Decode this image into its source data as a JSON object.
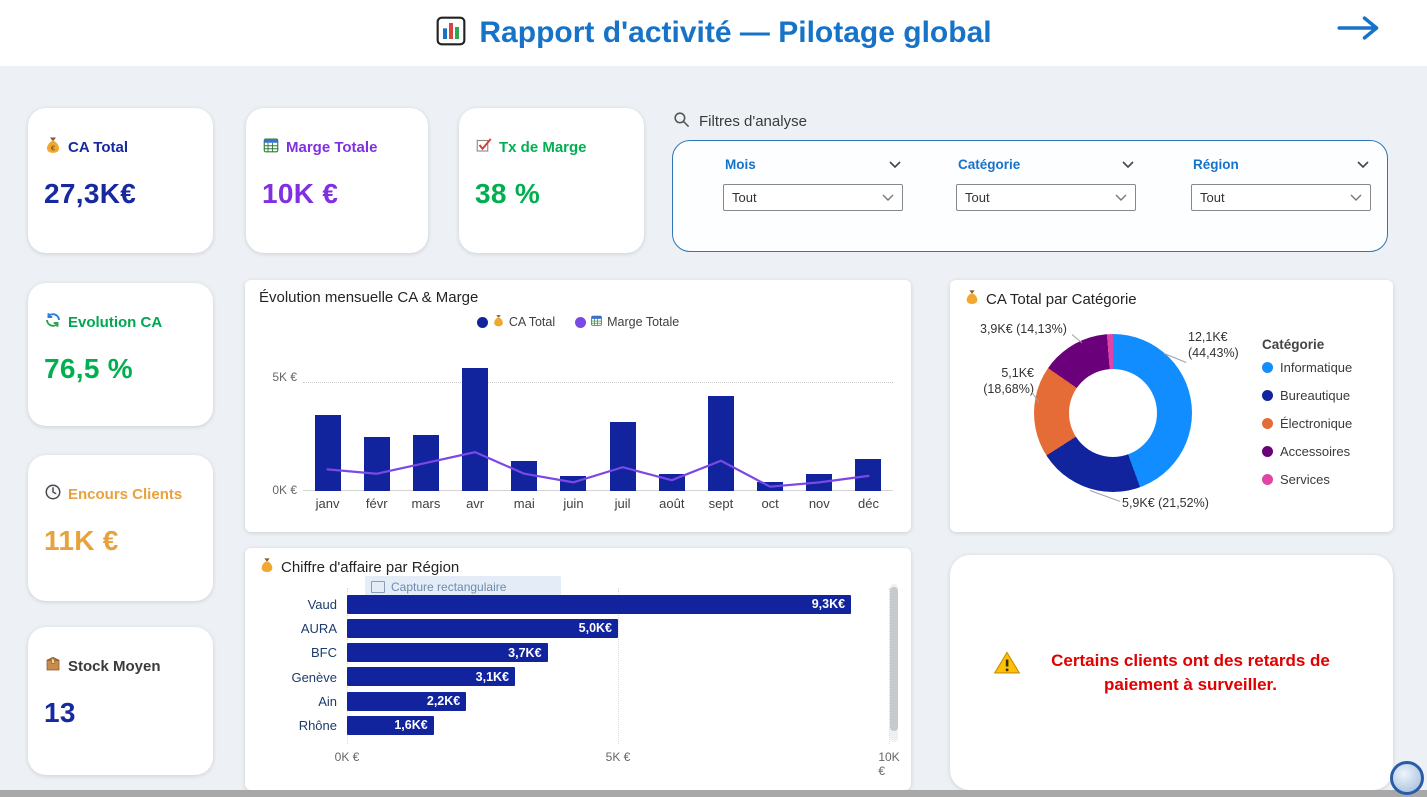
{
  "header": {
    "title": "Rapport d'activité — Pilotage global",
    "accent": "#1673C8"
  },
  "kpis": {
    "ca_total": {
      "label": "CA Total",
      "value": "27,3K€",
      "label_color": "#16299E",
      "value_color": "#16299E"
    },
    "marge_totale": {
      "label": "Marge Totale",
      "value": "10K €",
      "label_color": "#8030E0",
      "value_color": "#8030E0"
    },
    "tx_marge": {
      "label": "Tx de Marge",
      "value": "38 %",
      "label_color": "#00B050",
      "value_color": "#00B050"
    },
    "evolution_ca": {
      "label": "Evolution CA",
      "value": "76,5 %",
      "label_color": "#00A651",
      "value_color": "#00B050"
    },
    "encours_clients": {
      "label": "Encours Clients",
      "value": "11K €",
      "label_color": "#E9A23B",
      "value_color": "#E9A23B"
    },
    "stock_moyen": {
      "label": "Stock Moyen",
      "value": "13",
      "label_color": "#3a3a3a",
      "value_color": "#16299E"
    }
  },
  "filters": {
    "title": "Filtres d'analyse",
    "items": [
      {
        "label": "Mois",
        "value": "Tout"
      },
      {
        "label": "Catégorie",
        "value": "Tout"
      },
      {
        "label": "Région",
        "value": "Tout"
      }
    ]
  },
  "alert": {
    "text": "Certains clients ont des retards de paiement à surveiller."
  },
  "capture_overlay": "Capture rectangulaire",
  "chart_data": [
    {
      "type": "bar",
      "subtype": "combo-column-line",
      "title": "Évolution mensuelle CA & Marge",
      "categories": [
        "janv",
        "févr",
        "mars",
        "avr",
        "mai",
        "juin",
        "juil",
        "août",
        "sept",
        "oct",
        "nov",
        "déc"
      ],
      "series": [
        {
          "name": "CA Total",
          "chart": "column",
          "color": "#12239E",
          "values": [
            3500,
            2500,
            2600,
            5700,
            1400,
            700,
            3200,
            800,
            4400,
            400,
            800,
            1500
          ]
        },
        {
          "name": "Marge Totale",
          "chart": "line",
          "color": "#7B48E8",
          "values": [
            1000,
            800,
            1300,
            1800,
            800,
            400,
            1100,
            500,
            1400,
            200,
            400,
            700
          ]
        }
      ],
      "ylim": [
        0,
        6000
      ],
      "yticks": [
        "0K €",
        "5K €"
      ],
      "legend_position": "top"
    },
    {
      "type": "pie",
      "title": "CA Total par Catégorie",
      "legend_title": "Catégorie",
      "slices": [
        {
          "label": "Informatique",
          "value": "12,1K€",
          "pct": 44.43,
          "color": "#118DFF"
        },
        {
          "label": "Bureautique",
          "value": "5,9K€",
          "pct": 21.52,
          "color": "#12239E"
        },
        {
          "label": "Électronique",
          "value": "5,1K€",
          "pct": 18.68,
          "color": "#E66C37"
        },
        {
          "label": "Accessoires",
          "value": "3,9K€",
          "pct": 14.13,
          "color": "#6B007B"
        },
        {
          "label": "Services",
          "pct": 1.24,
          "color": "#E044A7"
        }
      ],
      "callouts": {
        "accessoires": "3,9K€ (14,13%)",
        "informatique": "12,1K€\n(44,43%)",
        "electronique": "5,1K€\n(18,68%)",
        "bureautique": "5,9K€ (21,52%)"
      }
    },
    {
      "type": "bar",
      "orientation": "horizontal",
      "title": "Chiffre d'affaire par Région",
      "categories": [
        "Vaud",
        "AURA",
        "BFC",
        "Genève",
        "Ain",
        "Rhône"
      ],
      "values": [
        9300,
        5000,
        3700,
        3100,
        2200,
        1600
      ],
      "bar_labels": [
        "9,3K€",
        "5,0K€",
        "3,7K€",
        "3,1K€",
        "2,2K€",
        "1,6K€"
      ],
      "color": "#12239E",
      "xticks": [
        "0K €",
        "5K €",
        "10K €"
      ],
      "xtick_values": [
        0,
        5000,
        10000
      ],
      "xlim": [
        0,
        10500
      ]
    }
  ]
}
